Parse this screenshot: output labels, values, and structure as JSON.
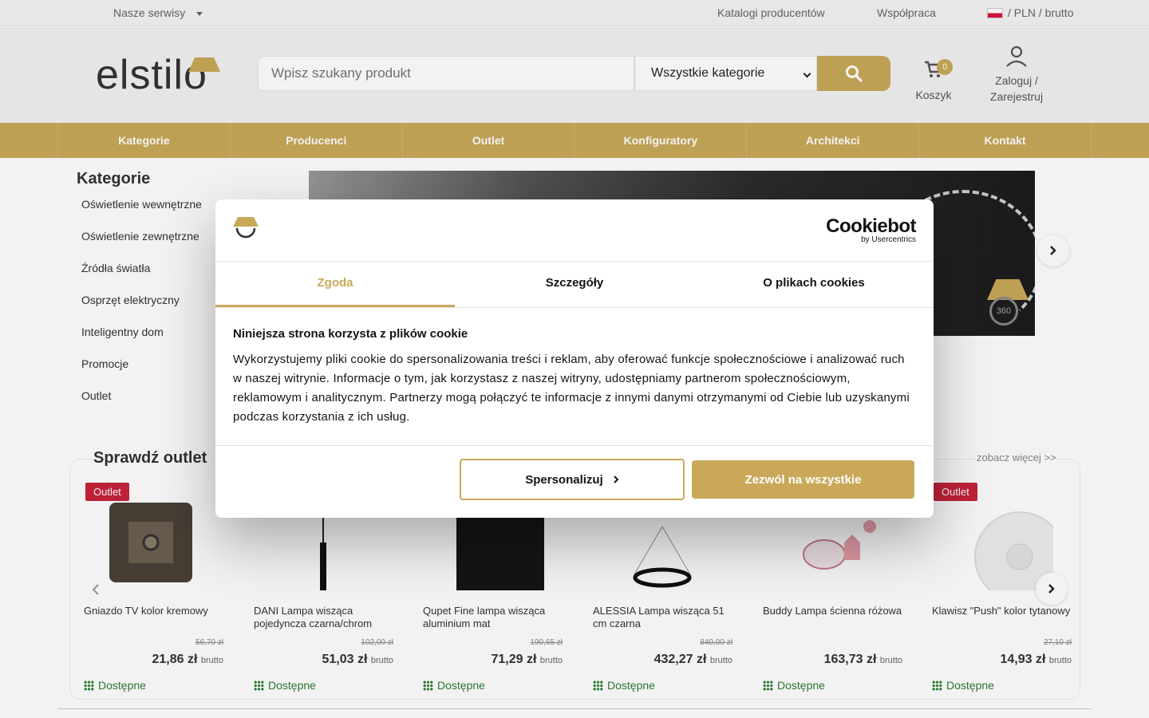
{
  "topbar": {
    "services": "Nasze serwisy",
    "catalogs": "Katalogi producentów",
    "cooperation": "Współpraca",
    "locale": "/ PLN / brutto"
  },
  "header": {
    "logo": "elstilo",
    "search_placeholder": "Wpisz szukany produkt",
    "category_select": "Wszystkie kategorie",
    "cart_count": "0",
    "cart_label": "Koszyk",
    "login_label": "Zaloguj / Zarejestruj"
  },
  "nav": [
    "Kategorie",
    "Producenci",
    "Outlet",
    "Konfiguratory",
    "Architekci",
    "Kontakt"
  ],
  "sidebar": {
    "title": "Kategorie",
    "items": [
      "Oświetlenie wewnętrzne",
      "Oświetlenie zewnętrzne",
      "Źródła światła",
      "Osprzęt elektryczny",
      "Inteligentny dom",
      "Promocje",
      "Outlet"
    ]
  },
  "banner": {
    "badge_360": "360"
  },
  "outlet": {
    "title": "Sprawdź outlet",
    "see_more": "zobacz więcej >>",
    "products": [
      {
        "badge": "Outlet",
        "name": "Gniazdo TV kolor kremowy",
        "old_price": "56,70 zł",
        "price": "21,86 zł",
        "unit": "brutto",
        "availability": "Dostępne"
      },
      {
        "badge": "",
        "name": "DANI Lampa wisząca pojedyncza czarna/chrom",
        "old_price": "102,00 zł",
        "price": "51,03 zł",
        "unit": "brutto",
        "availability": "Dostępne"
      },
      {
        "badge": "",
        "name": "Qupet Fine lampa wisząca aluminium mat",
        "old_price": "190,65 zł",
        "price": "71,29 zł",
        "unit": "brutto",
        "availability": "Dostępne"
      },
      {
        "badge": "",
        "name": "ALESSIA Lampa wisząca 51 cm czarna",
        "old_price": "840,00 zł",
        "price": "432,27 zł",
        "unit": "brutto",
        "availability": "Dostępne"
      },
      {
        "badge": "",
        "name": "Buddy Lampa ścienna różowa",
        "old_price": "",
        "price": "163,73 zł",
        "unit": "brutto",
        "availability": "Dostępne"
      },
      {
        "badge": "Outlet",
        "name": "Klawisz \"Push\" kolor tytanowy",
        "old_price": "27,10 zł",
        "price": "14,93 zł",
        "unit": "brutto",
        "availability": "Dostępne"
      }
    ]
  },
  "cookie_dialog": {
    "brand": "Cookiebot",
    "brand_sub": "by Usercentrics",
    "tabs": [
      "Zgoda",
      "Szczegóły",
      "O plikach cookies"
    ],
    "heading": "Niniejsza strona korzysta z plików cookie",
    "body": "Wykorzystujemy pliki cookie do spersonalizowania treści i reklam, aby oferować funkcje społecznościowe i analizować ruch w naszej witrynie. Informacje o tym, jak korzystasz z naszej witryny, udostępniamy partnerom społecznościowym, reklamowym i analitycznym. Partnerzy mogą połączyć te informacje z innymi danymi otrzymanymi od Ciebie lub uzyskanymi podczas korzystania z ich usług.",
    "personalize": "Spersonalizuj",
    "allow_all": "Zezwól na wszystkie"
  },
  "colors": {
    "accent": "#c9a959",
    "outlet_badge": "#c8233a",
    "available": "#2d7d32"
  }
}
